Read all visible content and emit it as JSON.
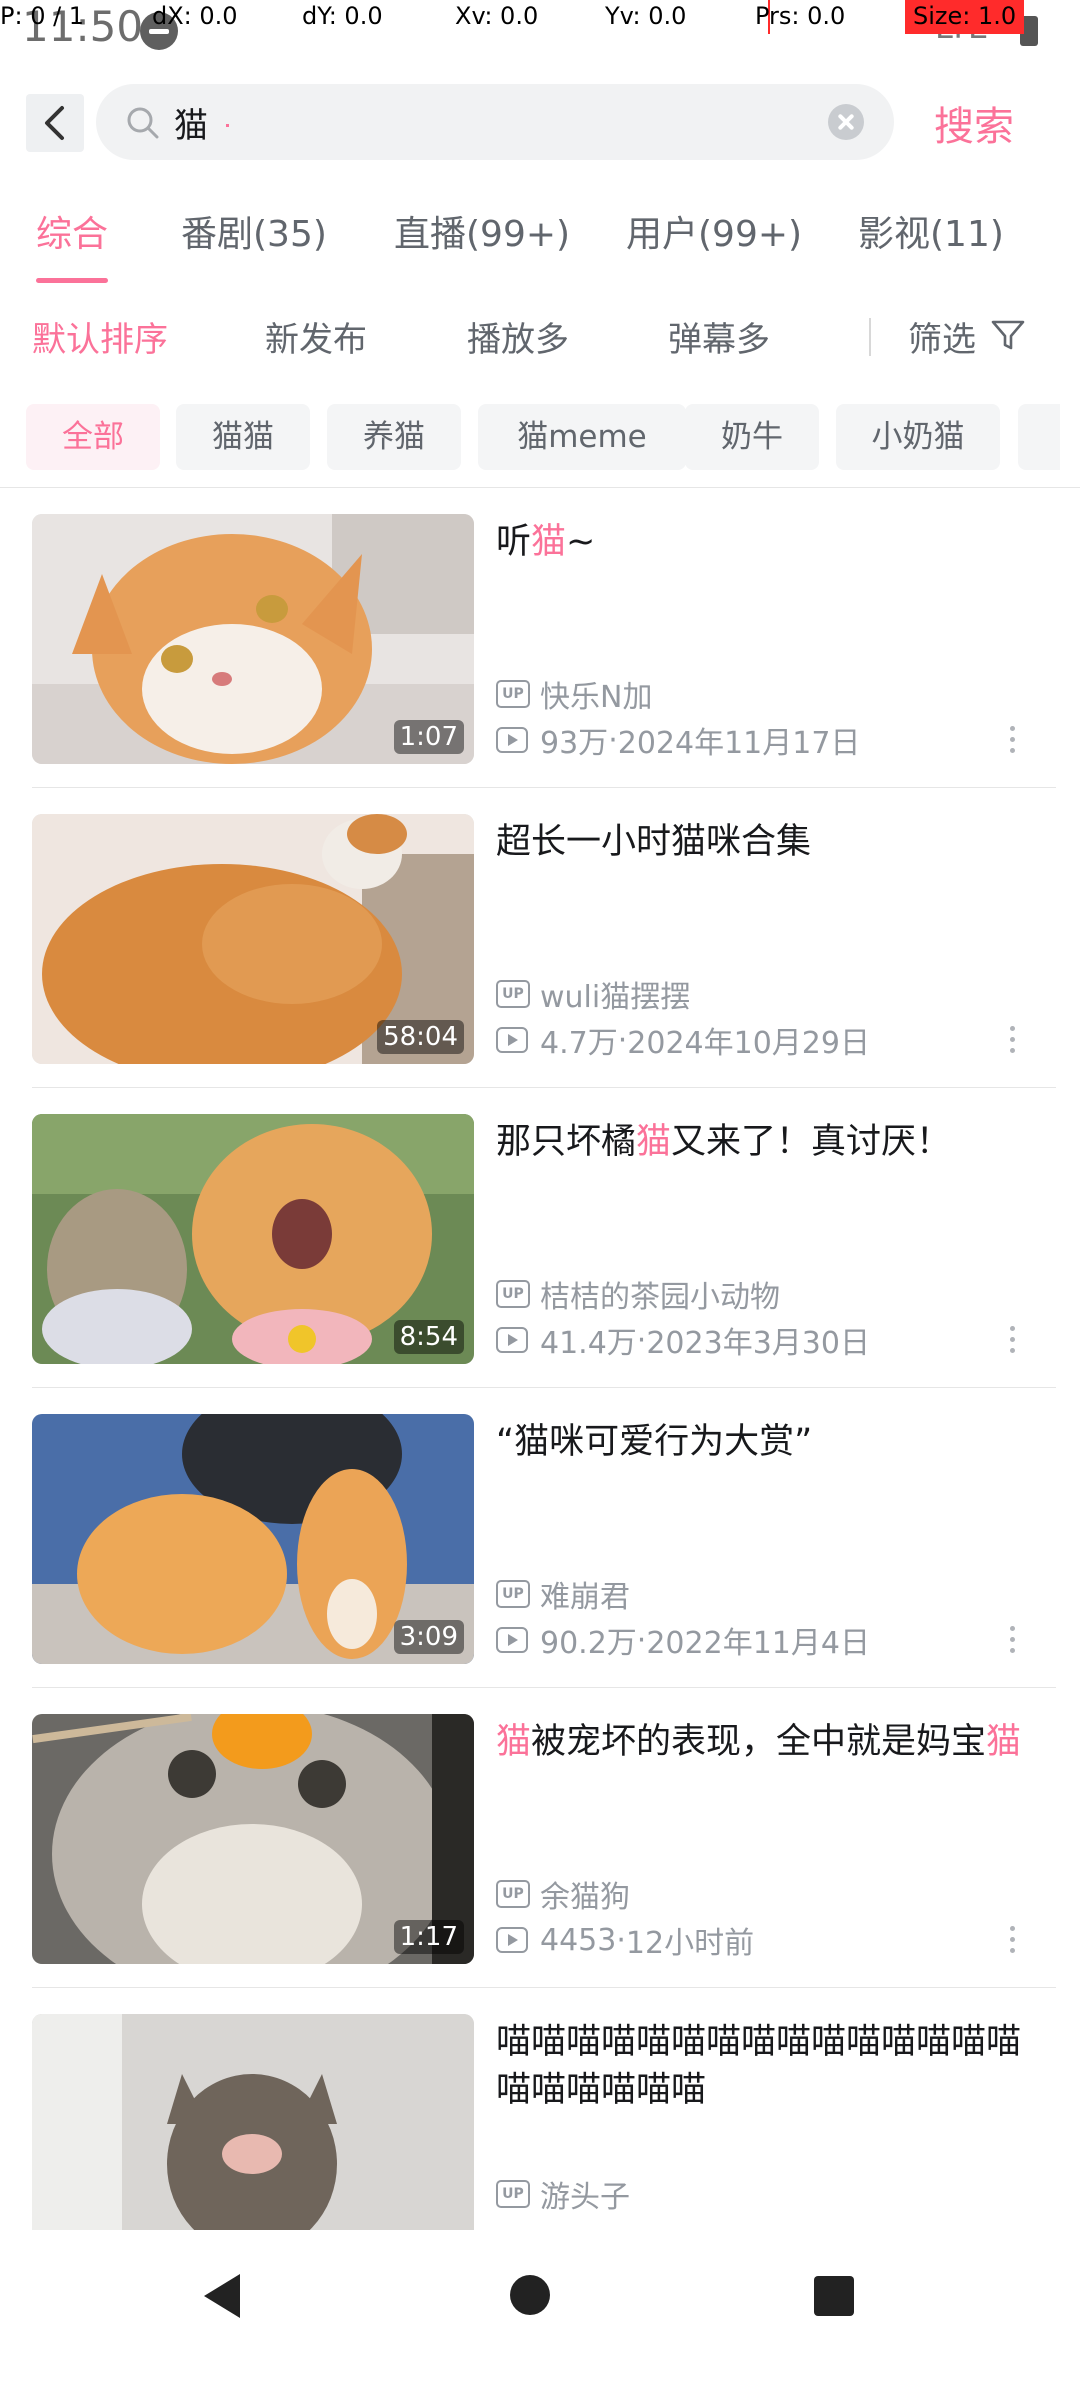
{
  "status_bar": {
    "time": "11:50",
    "signal": "LTE",
    "debug": {
      "p": "P: 0 / 1",
      "dx": "dX: 0.0",
      "dy": "dY: 0.0",
      "xv": "Xv: 0.0",
      "yv": "Yv: 0.0",
      "prs": "Prs: 0.0",
      "size": "Size: 1.0"
    }
  },
  "header": {
    "search_value": "猫",
    "search_button": "搜索"
  },
  "tabs": [
    {
      "label": "综合",
      "active": true
    },
    {
      "label": "番剧(35)"
    },
    {
      "label": "直播(99+)"
    },
    {
      "label": "用户(99+)"
    },
    {
      "label": "影视(11)"
    }
  ],
  "sort": {
    "options": [
      {
        "label": "默认排序",
        "active": true
      },
      {
        "label": "新发布"
      },
      {
        "label": "播放多"
      },
      {
        "label": "弹幕多"
      }
    ],
    "filter_label": "筛选"
  },
  "chips": [
    {
      "label": "全部",
      "active": true
    },
    {
      "label": "猫猫"
    },
    {
      "label": "养猫"
    },
    {
      "label": "猫meme"
    },
    {
      "label": "奶牛"
    },
    {
      "label": "小奶猫"
    }
  ],
  "videos": [
    {
      "title_parts": [
        "听",
        "猫",
        "~"
      ],
      "uploader": "快乐N加",
      "views": "93万",
      "date": "2024年11月17日",
      "duration": "1:07"
    },
    {
      "title_parts": [
        "超长一小时猫咪合集",
        "",
        ""
      ],
      "uploader": "wuli猫摆摆",
      "views": "4.7万",
      "date": "2024年10月29日",
      "duration": "58:04"
    },
    {
      "title_parts": [
        "那只坏橘",
        "猫",
        "又来了！真讨厌！"
      ],
      "uploader": "桔桔的茶园小动物",
      "views": "41.4万",
      "date": "2023年3月30日",
      "duration": "8:54"
    },
    {
      "title_parts": [
        "“猫咪可爱行为大赏”",
        "",
        ""
      ],
      "uploader": "难崩君",
      "views": "90.2万",
      "date": "2022年11月4日",
      "duration": "3:09"
    },
    {
      "title_parts": [
        "",
        "猫",
        "被宠坏的表现，全中就是妈宝",
        "猫"
      ],
      "uploader": "余猫狗",
      "views": "4453",
      "date": "12小时前",
      "duration": "1:17"
    },
    {
      "title_parts": [
        "喵喵喵喵喵喵喵喵喵喵喵喵喵喵喵喵喵喵喵喵喵",
        "",
        ""
      ],
      "uploader": "游头子",
      "views": "",
      "date": "",
      "duration": ""
    }
  ],
  "labels": {
    "up_badge": "UP",
    "dot": " · "
  },
  "colors": {
    "accent": "#fb7299",
    "text": "#18191c",
    "muted": "#9499a0"
  }
}
